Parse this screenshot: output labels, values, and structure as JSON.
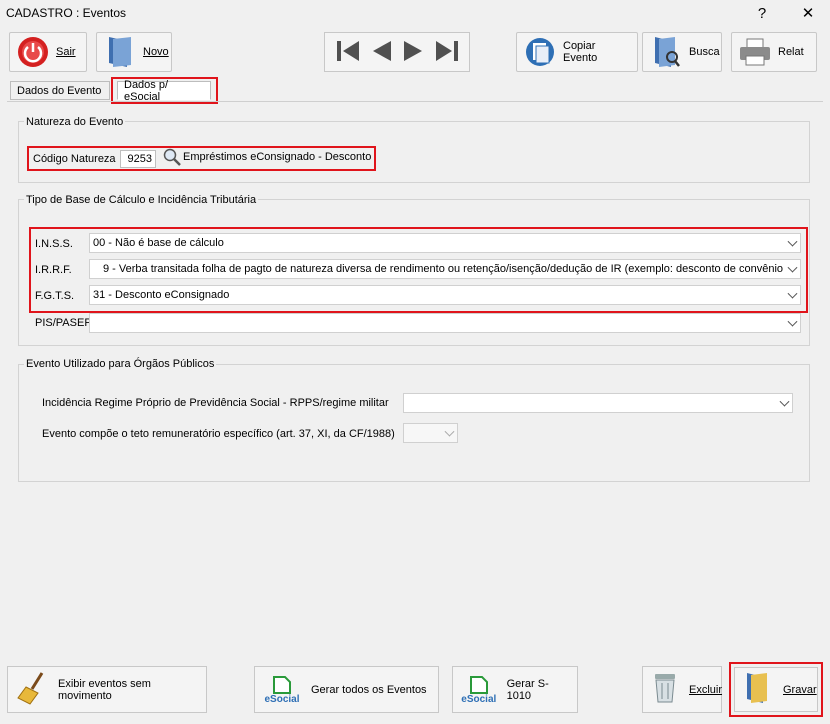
{
  "window": {
    "title": "CADASTRO : Eventos",
    "help": "?",
    "close": "✕"
  },
  "toolbar": {
    "sair": "Sair",
    "novo": "Novo",
    "copiar": "Copiar Evento",
    "busca": "Busca",
    "relat": "Relat"
  },
  "tabs": [
    {
      "label": "Dados do Evento"
    },
    {
      "label": "Dados p/ eSocial"
    }
  ],
  "natureza": {
    "group_title": "Natureza do Evento",
    "label": "Código Natureza",
    "code": "9253",
    "description": "Empréstimos eConsignado - Desconto"
  },
  "tributaria": {
    "group_title": "Tipo de Base de Cálculo e Incidência Tributária",
    "inss_label": "I.N.S.S.",
    "inss_value": "00 - Não é base de cálculo",
    "irrf_label": "I.R.R.F.",
    "irrf_value": "9 - Verba transitada folha de pagto de natureza diversa de rendimento ou retenção/isenção/dedução de IR (exemplo: desconto de convênio",
    "fgts_label": "F.G.T.S.",
    "fgts_value": "31 - Desconto eConsignado",
    "pis_label": "PIS/PASEP",
    "pis_value": ""
  },
  "orgaos": {
    "group_title": "Evento Utilizado para Órgãos Públicos",
    "rpps_label": "Incidência Regime Próprio de Previdência Social - RPPS/regime militar",
    "rpps_value": "",
    "teto_label": "Evento compõe o teto remuneratório específico (art. 37, XI, da CF/1988)",
    "teto_value": ""
  },
  "footer": {
    "exibir": "Exibir eventos sem movimento",
    "gerar_todos": "Gerar todos os Eventos",
    "gerar_s1010": "Gerar S-1010",
    "esocial_logo": "eSocial",
    "excluir": "Excluir",
    "gravar": "Gravar"
  },
  "colors": {
    "highlight": "#e0141b",
    "accent_blue": "#2e6fb5"
  }
}
